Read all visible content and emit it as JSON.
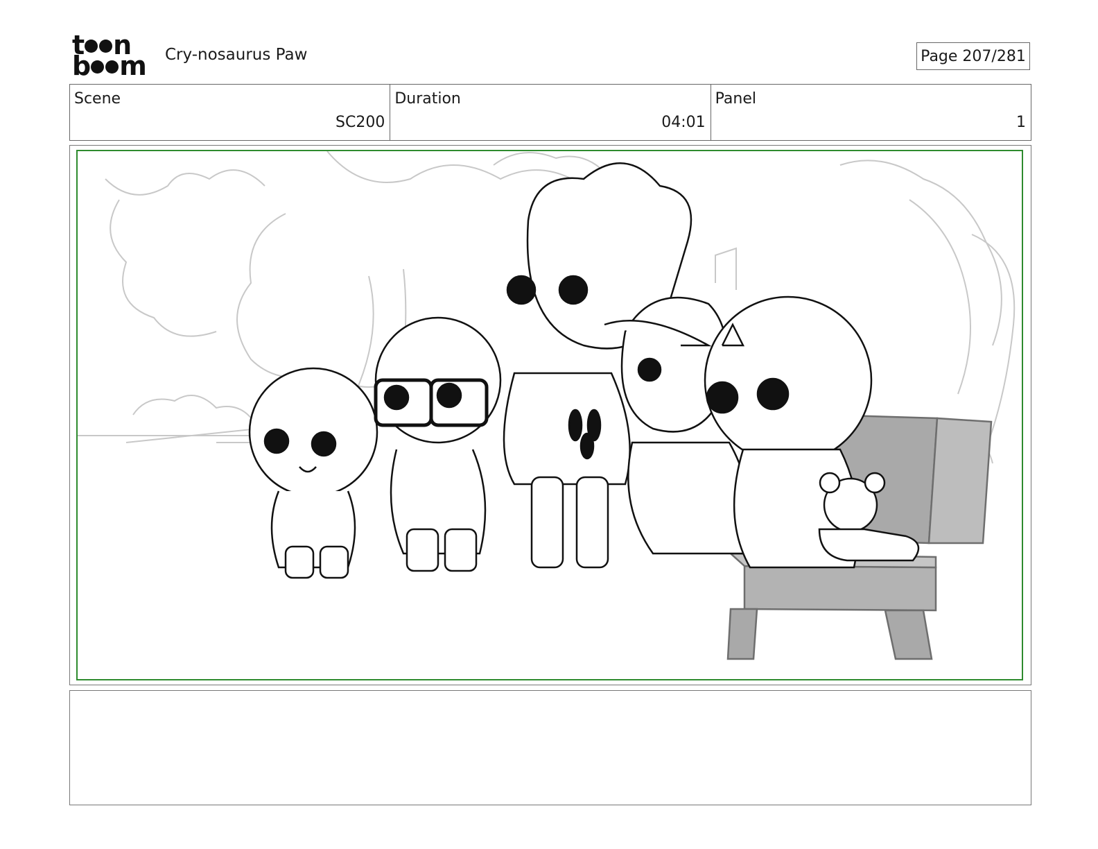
{
  "header": {
    "logo_text": "toon boom",
    "project_title": "Cry-nosaurus Paw",
    "page_indicator": "Page 207/281"
  },
  "meta": {
    "scene_label": "Scene",
    "scene_value": "SC200",
    "duration_label": "Duration",
    "duration_value": "04:01",
    "panel_label": "Panel",
    "panel_value": "1"
  },
  "colors": {
    "safe_frame": "#2e8b2e",
    "bench": "#a9a9a9",
    "background_sketch": "#c8c8c8"
  },
  "notes": {
    "text": ""
  }
}
